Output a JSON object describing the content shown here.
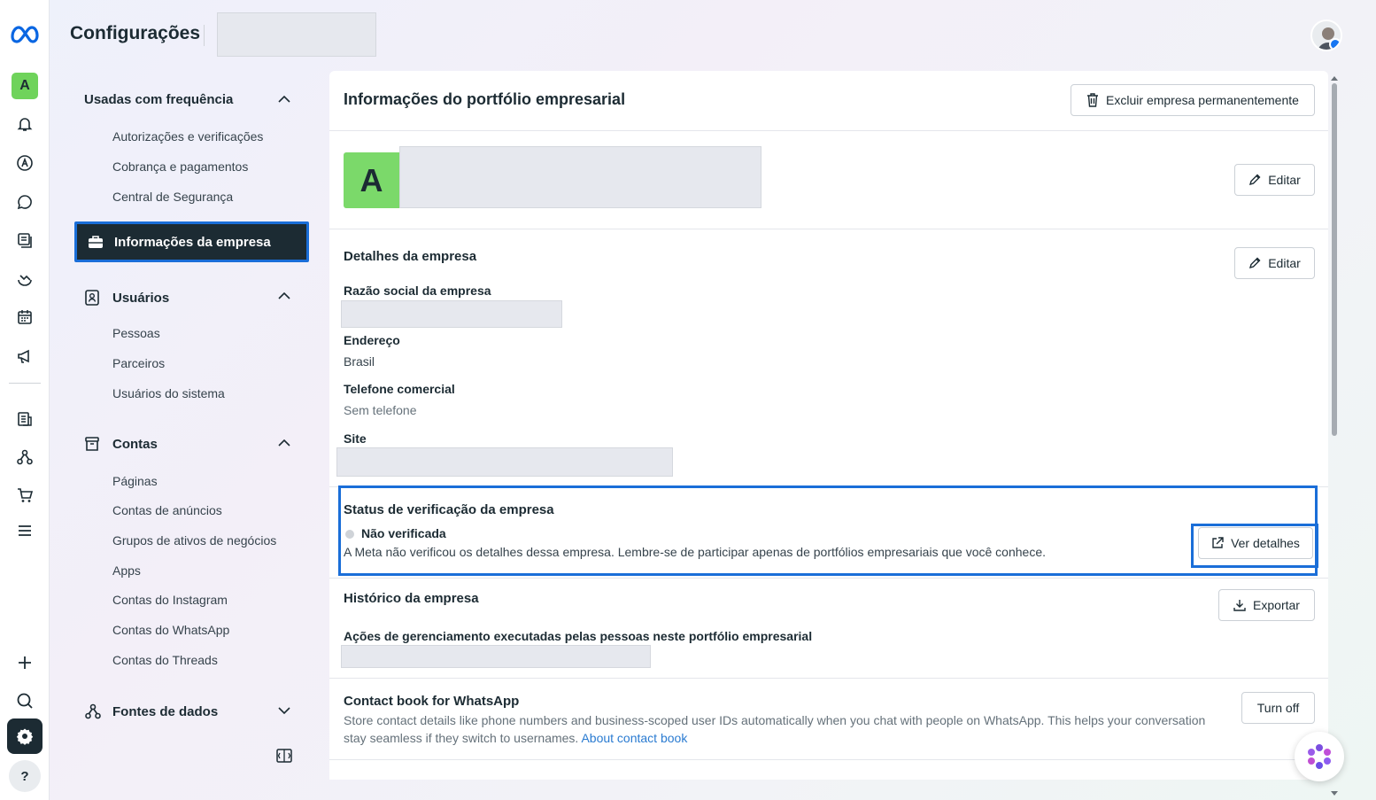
{
  "app": {
    "title": "Configurações"
  },
  "rail": {
    "account_initial": "A",
    "help_label": "?"
  },
  "sidebar": {
    "frequent": {
      "title": "Usadas com frequência",
      "items": [
        "Autorizações e verificações",
        "Cobrança e pagamentos",
        "Central de Segurança"
      ]
    },
    "active_item": "Informações da empresa",
    "users": {
      "title": "Usuários",
      "items": [
        "Pessoas",
        "Parceiros",
        "Usuários do sistema"
      ]
    },
    "accounts": {
      "title": "Contas",
      "items": [
        "Páginas",
        "Contas de anúncios",
        "Grupos de ativos de negócios",
        "Apps",
        "Contas do Instagram",
        "Contas do WhatsApp",
        "Contas do Threads"
      ]
    },
    "data_sources": {
      "title": "Fontes de dados"
    }
  },
  "main": {
    "title": "Informações do portfólio empresarial",
    "delete_button": "Excluir empresa permanentemente",
    "profile": {
      "initial": "A",
      "edit_button": "Editar"
    },
    "details": {
      "title": "Detalhes da empresa",
      "edit_button": "Editar",
      "legal_name_label": "Razão social da empresa",
      "address_label": "Endereço",
      "address_value": "Brasil",
      "phone_label": "Telefone comercial",
      "phone_value": "Sem telefone",
      "site_label": "Site"
    },
    "verification": {
      "title": "Status de verificação da empresa",
      "status": "Não verificada",
      "description": "A Meta não verificou os detalhes dessa empresa. Lembre-se de participar apenas de portfólios empresariais que você conhece.",
      "details_button": "Ver detalhes"
    },
    "history": {
      "title": "Histórico da empresa",
      "export_button": "Exportar",
      "actions_label": "Ações de gerenciamento executadas pelas pessoas neste portfólio empresarial"
    },
    "contact_book": {
      "title": "Contact book for WhatsApp",
      "description": "Store contact details like phone numbers and business-scoped user IDs automatically when you chat with people on WhatsApp. This helps your conversation stay seamless if they switch to usernames.",
      "link": "About contact book",
      "toggle_button": "Turn off"
    }
  },
  "colors": {
    "accent_highlight": "#1a6ed8",
    "nav_active_bg": "#1c2b33",
    "avatar_green": "#7bd96a",
    "link": "#2a7bd1"
  }
}
